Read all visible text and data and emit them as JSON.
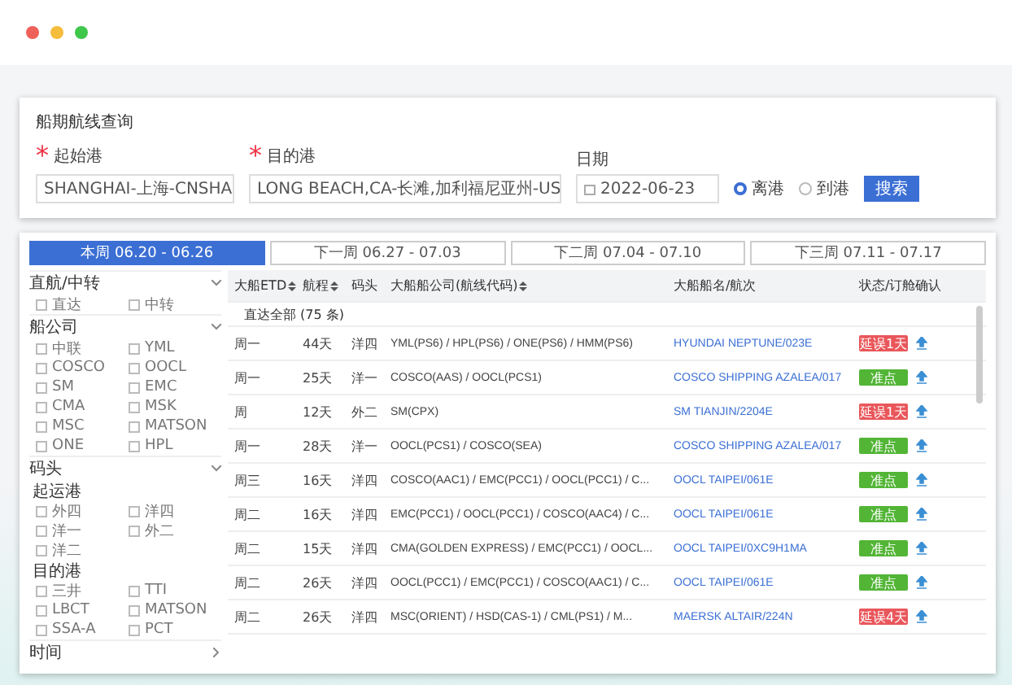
{
  "search": {
    "title": "船期航线查询",
    "fields": [
      {
        "mark": "*",
        "label": "起始港",
        "value": "SHANGHAI-上海-CNSHA",
        "kind": "select"
      },
      {
        "mark": "*",
        "label": "目的港",
        "value": "LONG BEACH,CA-长滩,加利福尼亚州-US",
        "kind": "select"
      },
      {
        "label": "日期",
        "value": "2022-06-23",
        "kind": "date"
      }
    ],
    "radios": [
      {
        "label": "离港",
        "selected": true
      },
      {
        "label": "到港",
        "selected": false
      }
    ],
    "button": "搜索"
  },
  "tabs": [
    {
      "label": "本周 06.20 - 06.26",
      "selected": true
    },
    {
      "label": "下一周 06.27 - 07.03",
      "selected": false
    },
    {
      "label": "下二周 07.04 - 07.10",
      "selected": false
    },
    {
      "label": "下三周 07.11 - 07.17",
      "selected": false
    }
  ],
  "sidebar": {
    "sections": [
      {
        "title": "直航/中转",
        "expanded": true,
        "groups": [
          {
            "options": [
              {
                "label": "直达",
                "checked": false
              },
              {
                "label": "中转",
                "checked": false
              }
            ]
          }
        ]
      },
      {
        "title": "船公司",
        "expanded": true,
        "groups": [
          {
            "options": [
              {
                "label": "中联",
                "checked": false
              },
              {
                "label": "YML",
                "checked": false
              },
              {
                "label": "COSCO",
                "checked": false
              },
              {
                "label": "OOCL",
                "checked": false
              },
              {
                "label": "SM",
                "checked": false
              },
              {
                "label": "EMC",
                "checked": false
              },
              {
                "label": "CMA",
                "checked": false
              },
              {
                "label": "MSK",
                "checked": false
              },
              {
                "label": "MSC",
                "checked": false
              },
              {
                "label": "MATSON",
                "checked": false
              },
              {
                "label": "ONE",
                "checked": false
              },
              {
                "label": "HPL",
                "checked": false
              }
            ]
          }
        ]
      },
      {
        "title": "码头",
        "expanded": true,
        "groups": [
          {
            "title": "起运港",
            "options": [
              {
                "label": "外四",
                "checked": false
              },
              {
                "label": "洋四",
                "checked": false
              },
              {
                "label": "洋一",
                "checked": false
              },
              {
                "label": "外二",
                "checked": false
              },
              {
                "label": "洋二",
                "checked": false
              }
            ]
          },
          {
            "title": "目的港",
            "options": [
              {
                "label": "三井",
                "checked": false
              },
              {
                "label": "TTI",
                "checked": false
              },
              {
                "label": "LBCT",
                "checked": false
              },
              {
                "label": "MATSON",
                "checked": false
              },
              {
                "label": "SSA-A",
                "checked": false
              },
              {
                "label": "PCT",
                "checked": false
              }
            ]
          }
        ]
      },
      {
        "title": "时间",
        "expanded": false
      }
    ]
  },
  "table": {
    "columns": [
      {
        "label": "大船ETD",
        "sortable": true
      },
      {
        "label": "航程",
        "sortable": true
      },
      {
        "label": "码头",
        "sortable": false
      },
      {
        "label": "大船船公司(航线代码)",
        "sortable": true
      },
      {
        "label": "大船船名/航次",
        "sortable": false
      },
      {
        "label": "状态/订舱确认",
        "sortable": false
      }
    ],
    "group": "直达全部 (75 条)",
    "rows": [
      {
        "etd": "周一",
        "days": "44天",
        "terminal": "洋四",
        "carriers": "YML(PS6) / HPL(PS6) / ONE(PS6) / HMM(PS6)",
        "vessel": "HYUNDAI NEPTUNE/023E",
        "status": "延误1天",
        "kind": "delay"
      },
      {
        "etd": "周一",
        "days": "25天",
        "terminal": "洋一",
        "carriers": "COSCO(AAS) / OOCL(PCS1)",
        "vessel": "COSCO SHIPPING AZALEA/017",
        "status": "准点",
        "kind": "ontime"
      },
      {
        "etd": "周",
        "days": "12天",
        "terminal": "外二",
        "carriers": "SM(CPX)",
        "vessel": "SM TIANJIN/2204E",
        "status": "延误1天",
        "kind": "delay"
      },
      {
        "etd": "周一",
        "days": "28天",
        "terminal": "洋一",
        "carriers": "OOCL(PCS1) / COSCO(SEA)",
        "vessel": "COSCO SHIPPING AZALEA/017",
        "status": "准点",
        "kind": "ontime"
      },
      {
        "etd": "周三",
        "days": "16天",
        "terminal": "洋四",
        "carriers": "COSCO(AAC1) / EMC(PCC1) / OOCL(PCC1) / C...",
        "vessel": "OOCL TAIPEI/061E",
        "status": "准点",
        "kind": "ontime"
      },
      {
        "etd": "周二",
        "days": "16天",
        "terminal": "洋四",
        "carriers": "EMC(PCC1) / OOCL(PCC1) / COSCO(AAC4) / C...",
        "vessel": "OOCL TAIPEI/061E",
        "status": "准点",
        "kind": "ontime"
      },
      {
        "etd": "周二",
        "days": "15天",
        "terminal": "洋四",
        "carriers": "CMA(GOLDEN EXPRESS) / EMC(PCC1) / OOCL...",
        "vessel": "OOCL TAIPEI/0XC9H1MA",
        "status": "准点",
        "kind": "ontime"
      },
      {
        "etd": "周二",
        "days": "26天",
        "terminal": "洋四",
        "carriers": "OOCL(PCC1) / EMC(PCC1) / COSCO(AAC1) / C...",
        "vessel": "OOCL TAIPEI/061E",
        "status": "准点",
        "kind": "ontime"
      },
      {
        "etd": "周二",
        "days": "26天",
        "terminal": "洋四",
        "carriers": "MSC(ORIENT) / HSD(CAS-1) / CML(PS1) / M...",
        "vessel": "MAERSK ALTAIR/224N",
        "status": "延误4天",
        "kind": "delay"
      }
    ]
  }
}
